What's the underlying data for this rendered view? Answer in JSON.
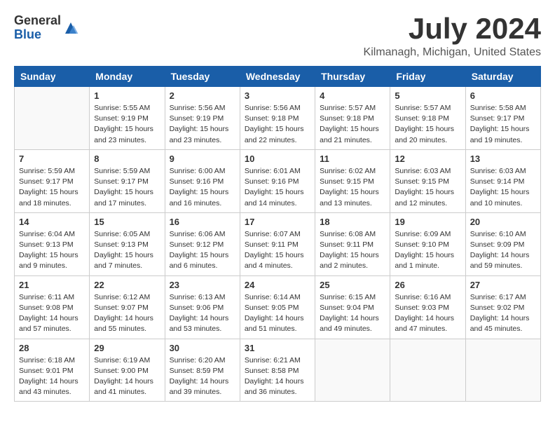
{
  "header": {
    "logo_general": "General",
    "logo_blue": "Blue",
    "title": "July 2024",
    "location": "Kilmanagh, Michigan, United States"
  },
  "days_of_week": [
    "Sunday",
    "Monday",
    "Tuesday",
    "Wednesday",
    "Thursday",
    "Friday",
    "Saturday"
  ],
  "weeks": [
    {
      "days": [
        {
          "number": "",
          "empty": true
        },
        {
          "number": "1",
          "sunrise": "Sunrise: 5:55 AM",
          "sunset": "Sunset: 9:19 PM",
          "daylight": "Daylight: 15 hours and 23 minutes."
        },
        {
          "number": "2",
          "sunrise": "Sunrise: 5:56 AM",
          "sunset": "Sunset: 9:19 PM",
          "daylight": "Daylight: 15 hours and 23 minutes."
        },
        {
          "number": "3",
          "sunrise": "Sunrise: 5:56 AM",
          "sunset": "Sunset: 9:18 PM",
          "daylight": "Daylight: 15 hours and 22 minutes."
        },
        {
          "number": "4",
          "sunrise": "Sunrise: 5:57 AM",
          "sunset": "Sunset: 9:18 PM",
          "daylight": "Daylight: 15 hours and 21 minutes."
        },
        {
          "number": "5",
          "sunrise": "Sunrise: 5:57 AM",
          "sunset": "Sunset: 9:18 PM",
          "daylight": "Daylight: 15 hours and 20 minutes."
        },
        {
          "number": "6",
          "sunrise": "Sunrise: 5:58 AM",
          "sunset": "Sunset: 9:17 PM",
          "daylight": "Daylight: 15 hours and 19 minutes."
        }
      ]
    },
    {
      "days": [
        {
          "number": "7",
          "sunrise": "Sunrise: 5:59 AM",
          "sunset": "Sunset: 9:17 PM",
          "daylight": "Daylight: 15 hours and 18 minutes."
        },
        {
          "number": "8",
          "sunrise": "Sunrise: 5:59 AM",
          "sunset": "Sunset: 9:17 PM",
          "daylight": "Daylight: 15 hours and 17 minutes."
        },
        {
          "number": "9",
          "sunrise": "Sunrise: 6:00 AM",
          "sunset": "Sunset: 9:16 PM",
          "daylight": "Daylight: 15 hours and 16 minutes."
        },
        {
          "number": "10",
          "sunrise": "Sunrise: 6:01 AM",
          "sunset": "Sunset: 9:16 PM",
          "daylight": "Daylight: 15 hours and 14 minutes."
        },
        {
          "number": "11",
          "sunrise": "Sunrise: 6:02 AM",
          "sunset": "Sunset: 9:15 PM",
          "daylight": "Daylight: 15 hours and 13 minutes."
        },
        {
          "number": "12",
          "sunrise": "Sunrise: 6:03 AM",
          "sunset": "Sunset: 9:15 PM",
          "daylight": "Daylight: 15 hours and 12 minutes."
        },
        {
          "number": "13",
          "sunrise": "Sunrise: 6:03 AM",
          "sunset": "Sunset: 9:14 PM",
          "daylight": "Daylight: 15 hours and 10 minutes."
        }
      ]
    },
    {
      "days": [
        {
          "number": "14",
          "sunrise": "Sunrise: 6:04 AM",
          "sunset": "Sunset: 9:13 PM",
          "daylight": "Daylight: 15 hours and 9 minutes."
        },
        {
          "number": "15",
          "sunrise": "Sunrise: 6:05 AM",
          "sunset": "Sunset: 9:13 PM",
          "daylight": "Daylight: 15 hours and 7 minutes."
        },
        {
          "number": "16",
          "sunrise": "Sunrise: 6:06 AM",
          "sunset": "Sunset: 9:12 PM",
          "daylight": "Daylight: 15 hours and 6 minutes."
        },
        {
          "number": "17",
          "sunrise": "Sunrise: 6:07 AM",
          "sunset": "Sunset: 9:11 PM",
          "daylight": "Daylight: 15 hours and 4 minutes."
        },
        {
          "number": "18",
          "sunrise": "Sunrise: 6:08 AM",
          "sunset": "Sunset: 9:11 PM",
          "daylight": "Daylight: 15 hours and 2 minutes."
        },
        {
          "number": "19",
          "sunrise": "Sunrise: 6:09 AM",
          "sunset": "Sunset: 9:10 PM",
          "daylight": "Daylight: 15 hours and 1 minute."
        },
        {
          "number": "20",
          "sunrise": "Sunrise: 6:10 AM",
          "sunset": "Sunset: 9:09 PM",
          "daylight": "Daylight: 14 hours and 59 minutes."
        }
      ]
    },
    {
      "days": [
        {
          "number": "21",
          "sunrise": "Sunrise: 6:11 AM",
          "sunset": "Sunset: 9:08 PM",
          "daylight": "Daylight: 14 hours and 57 minutes."
        },
        {
          "number": "22",
          "sunrise": "Sunrise: 6:12 AM",
          "sunset": "Sunset: 9:07 PM",
          "daylight": "Daylight: 14 hours and 55 minutes."
        },
        {
          "number": "23",
          "sunrise": "Sunrise: 6:13 AM",
          "sunset": "Sunset: 9:06 PM",
          "daylight": "Daylight: 14 hours and 53 minutes."
        },
        {
          "number": "24",
          "sunrise": "Sunrise: 6:14 AM",
          "sunset": "Sunset: 9:05 PM",
          "daylight": "Daylight: 14 hours and 51 minutes."
        },
        {
          "number": "25",
          "sunrise": "Sunrise: 6:15 AM",
          "sunset": "Sunset: 9:04 PM",
          "daylight": "Daylight: 14 hours and 49 minutes."
        },
        {
          "number": "26",
          "sunrise": "Sunrise: 6:16 AM",
          "sunset": "Sunset: 9:03 PM",
          "daylight": "Daylight: 14 hours and 47 minutes."
        },
        {
          "number": "27",
          "sunrise": "Sunrise: 6:17 AM",
          "sunset": "Sunset: 9:02 PM",
          "daylight": "Daylight: 14 hours and 45 minutes."
        }
      ]
    },
    {
      "days": [
        {
          "number": "28",
          "sunrise": "Sunrise: 6:18 AM",
          "sunset": "Sunset: 9:01 PM",
          "daylight": "Daylight: 14 hours and 43 minutes."
        },
        {
          "number": "29",
          "sunrise": "Sunrise: 6:19 AM",
          "sunset": "Sunset: 9:00 PM",
          "daylight": "Daylight: 14 hours and 41 minutes."
        },
        {
          "number": "30",
          "sunrise": "Sunrise: 6:20 AM",
          "sunset": "Sunset: 8:59 PM",
          "daylight": "Daylight: 14 hours and 39 minutes."
        },
        {
          "number": "31",
          "sunrise": "Sunrise: 6:21 AM",
          "sunset": "Sunset: 8:58 PM",
          "daylight": "Daylight: 14 hours and 36 minutes."
        },
        {
          "number": "",
          "empty": true
        },
        {
          "number": "",
          "empty": true
        },
        {
          "number": "",
          "empty": true
        }
      ]
    }
  ]
}
